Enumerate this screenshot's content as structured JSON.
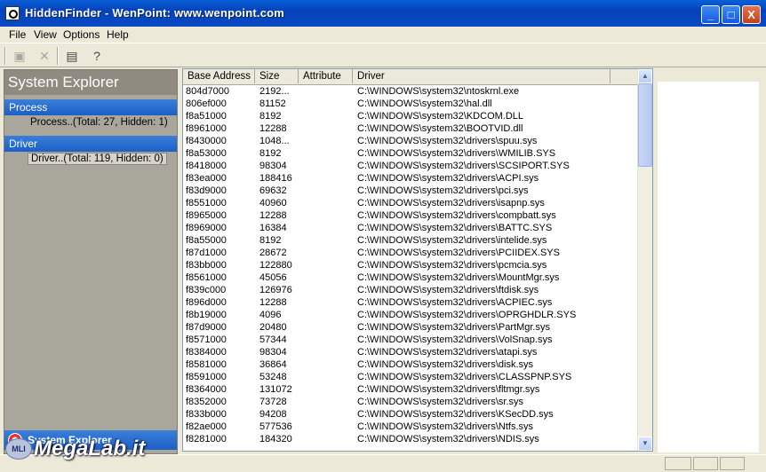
{
  "window": {
    "title": "HiddenFinder  -  WenPoint: www.wenpoint.com"
  },
  "title_buttons": {
    "minimize": "_",
    "maximize": "□",
    "close": "X"
  },
  "menu": [
    {
      "label": "File"
    },
    {
      "label": "View"
    },
    {
      "label": "Options"
    },
    {
      "label": "Help"
    }
  ],
  "toolbar": {
    "icons": [
      "properties-icon",
      "delete-icon",
      "export-icon",
      "help-icon"
    ]
  },
  "sidebar": {
    "title": "System Explorer",
    "groups": [
      {
        "header": "Process",
        "item": "Process..(Total: 27, Hidden: 1)"
      },
      {
        "header": "Driver",
        "item": "Driver..(Total: 119, Hidden: 0)"
      }
    ],
    "bottom_tab": "System Explorer"
  },
  "table": {
    "columns": [
      "Base Address",
      "Size",
      "Attribute",
      "Driver"
    ],
    "rows": [
      [
        "804d7000",
        "2192...",
        "",
        "C:\\WINDOWS\\system32\\ntoskrnl.exe"
      ],
      [
        "806ef000",
        "81152",
        "",
        "C:\\WINDOWS\\system32\\hal.dll"
      ],
      [
        "f8a51000",
        "8192",
        "",
        "C:\\WINDOWS\\system32\\KDCOM.DLL"
      ],
      [
        "f8961000",
        "12288",
        "",
        "C:\\WINDOWS\\system32\\BOOTVID.dll"
      ],
      [
        "f8430000",
        "1048...",
        "",
        "C:\\WINDOWS\\system32\\drivers\\spuu.sys"
      ],
      [
        "f8a53000",
        "8192",
        "",
        "C:\\WINDOWS\\system32\\drivers\\WMILIB.SYS"
      ],
      [
        "f8418000",
        "98304",
        "",
        "C:\\WINDOWS\\system32\\drivers\\SCSIPORT.SYS"
      ],
      [
        "f83ea000",
        "188416",
        "",
        "C:\\WINDOWS\\system32\\drivers\\ACPI.sys"
      ],
      [
        "f83d9000",
        "69632",
        "",
        "C:\\WINDOWS\\system32\\drivers\\pci.sys"
      ],
      [
        "f8551000",
        "40960",
        "",
        "C:\\WINDOWS\\system32\\drivers\\isapnp.sys"
      ],
      [
        "f8965000",
        "12288",
        "",
        "C:\\WINDOWS\\system32\\drivers\\compbatt.sys"
      ],
      [
        "f8969000",
        "16384",
        "",
        "C:\\WINDOWS\\system32\\drivers\\BATTC.SYS"
      ],
      [
        "f8a55000",
        "8192",
        "",
        "C:\\WINDOWS\\system32\\drivers\\intelide.sys"
      ],
      [
        "f87d1000",
        "28672",
        "",
        "C:\\WINDOWS\\system32\\drivers\\PCIIDEX.SYS"
      ],
      [
        "f83bb000",
        "122880",
        "",
        "C:\\WINDOWS\\system32\\drivers\\pcmcia.sys"
      ],
      [
        "f8561000",
        "45056",
        "",
        "C:\\WINDOWS\\system32\\drivers\\MountMgr.sys"
      ],
      [
        "f839c000",
        "126976",
        "",
        "C:\\WINDOWS\\system32\\drivers\\ftdisk.sys"
      ],
      [
        "f896d000",
        "12288",
        "",
        "C:\\WINDOWS\\system32\\drivers\\ACPIEC.sys"
      ],
      [
        "f8b19000",
        "4096",
        "",
        "C:\\WINDOWS\\system32\\drivers\\OPRGHDLR.SYS"
      ],
      [
        "f87d9000",
        "20480",
        "",
        "C:\\WINDOWS\\system32\\drivers\\PartMgr.sys"
      ],
      [
        "f8571000",
        "57344",
        "",
        "C:\\WINDOWS\\system32\\drivers\\VolSnap.sys"
      ],
      [
        "f8384000",
        "98304",
        "",
        "C:\\WINDOWS\\system32\\drivers\\atapi.sys"
      ],
      [
        "f8581000",
        "36864",
        "",
        "C:\\WINDOWS\\system32\\drivers\\disk.sys"
      ],
      [
        "f8591000",
        "53248",
        "",
        "C:\\WINDOWS\\system32\\drivers\\CLASSPNP.SYS"
      ],
      [
        "f8364000",
        "131072",
        "",
        "C:\\WINDOWS\\system32\\drivers\\fltmgr.sys"
      ],
      [
        "f8352000",
        "73728",
        "",
        "C:\\WINDOWS\\system32\\drivers\\sr.sys"
      ],
      [
        "f833b000",
        "94208",
        "",
        "C:\\WINDOWS\\system32\\drivers\\KSecDD.sys"
      ],
      [
        "f82ae000",
        "577536",
        "",
        "C:\\WINDOWS\\system32\\drivers\\Ntfs.sys"
      ],
      [
        "f8281000",
        "184320",
        "",
        "C:\\WINDOWS\\system32\\drivers\\NDIS.sys"
      ]
    ]
  },
  "watermark": {
    "text": "MegaLab.it",
    "badge": "MLI"
  },
  "colors": {
    "titlebar": "#0a49c6",
    "selection": "#1c5fc8",
    "panel": "#a9a69c"
  }
}
